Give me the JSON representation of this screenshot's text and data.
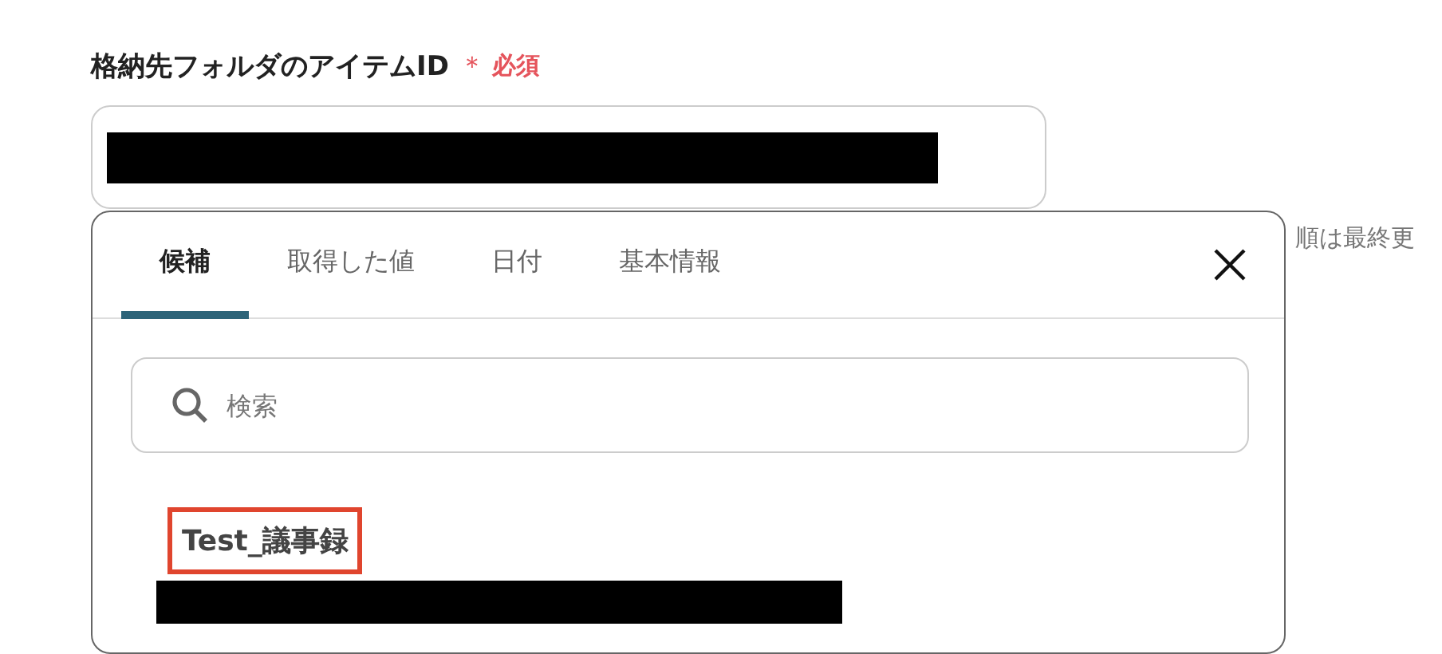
{
  "field": {
    "label": "格納先フォルダのアイテムID",
    "required_mark": "＊",
    "required_label": "必須",
    "value_redacted": true
  },
  "hint": "順は最終更",
  "popup": {
    "tabs": [
      {
        "label": "候補",
        "selected": true
      },
      {
        "label": "取得した値",
        "selected": false
      },
      {
        "label": "日付",
        "selected": false
      },
      {
        "label": "基本情報",
        "selected": false
      }
    ],
    "search": {
      "placeholder": "検索"
    },
    "items": [
      {
        "title": "Test_議事録",
        "highlighted": true,
        "detail_redacted": true
      }
    ]
  }
}
